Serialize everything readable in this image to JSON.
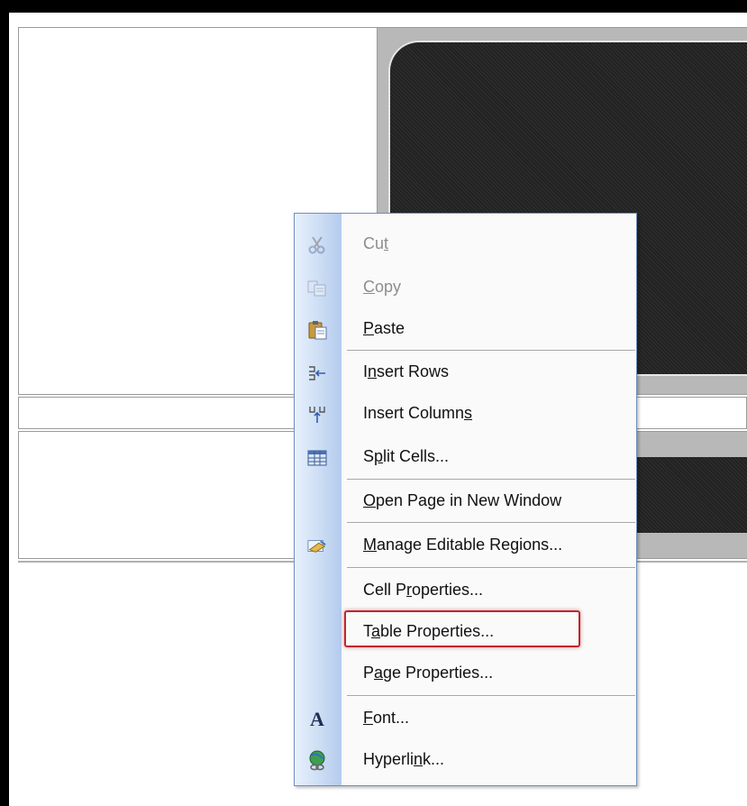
{
  "context_menu": {
    "items": [
      {
        "id": "cut",
        "label": "Cut",
        "mnemonic_index": 2,
        "icon": "scissors-icon",
        "disabled": true
      },
      {
        "id": "copy",
        "label": "Copy",
        "mnemonic_index": 0,
        "icon": "copy-icon",
        "disabled": true
      },
      {
        "id": "paste",
        "label": "Paste",
        "mnemonic_index": 0,
        "icon": "clipboard-paste-icon",
        "disabled": false
      },
      {
        "id": "insert-rows",
        "label": "Insert Rows",
        "mnemonic_index": 1,
        "icon": "insert-rows-icon",
        "disabled": false
      },
      {
        "id": "insert-columns",
        "label": "Insert Columns",
        "mnemonic_index": 13,
        "icon": "insert-columns-icon",
        "disabled": false
      },
      {
        "id": "split-cells",
        "label": "Split Cells...",
        "mnemonic_index": 1,
        "icon": "split-cells-icon",
        "disabled": false
      },
      {
        "id": "open-page-new-window",
        "label": "Open Page in New Window",
        "mnemonic_index": 0,
        "icon": "",
        "disabled": false
      },
      {
        "id": "manage-editable-regions",
        "label": "Manage Editable Regions...",
        "mnemonic_index": 0,
        "icon": "editable-regions-icon",
        "disabled": false
      },
      {
        "id": "cell-properties",
        "label": "Cell Properties...",
        "mnemonic_index": 6,
        "icon": "",
        "disabled": false
      },
      {
        "id": "table-properties",
        "label": "Table Properties...",
        "mnemonic_index": 1,
        "icon": "",
        "disabled": false,
        "highlighted": true
      },
      {
        "id": "page-properties",
        "label": "Page Properties...",
        "mnemonic_index": 1,
        "icon": "",
        "disabled": false
      },
      {
        "id": "font",
        "label": "Font...",
        "mnemonic_index": 0,
        "icon": "font-icon",
        "disabled": false
      },
      {
        "id": "hyperlink",
        "label": "Hyperlink...",
        "mnemonic_index": 7,
        "icon": "hyperlink-globe-icon",
        "disabled": false
      }
    ]
  },
  "colors": {
    "highlight_border": "#c0262c",
    "menu_border": "#6f8fc0",
    "gutter": "#c9dbf3",
    "dark_panel": "#262626",
    "gray_region": "#b8b8b8"
  }
}
